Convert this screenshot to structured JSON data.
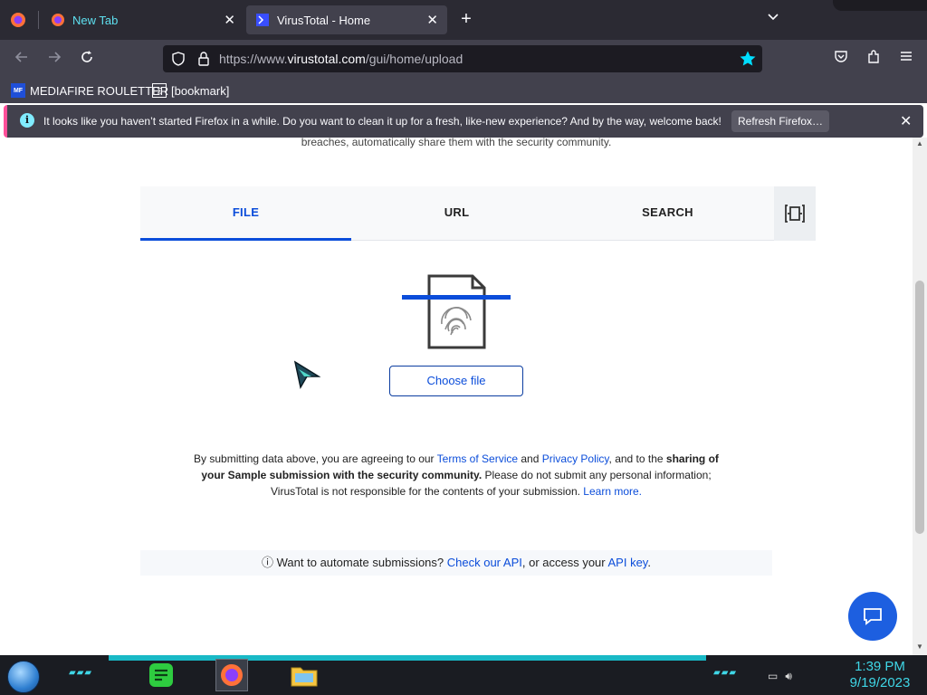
{
  "browser": {
    "tabs": [
      {
        "title": "New Tab",
        "active": false
      },
      {
        "title": "VirusTotal - Home",
        "active": true
      }
    ],
    "url_prefix": "https://www.",
    "url_domain": "virustotal.com",
    "url_path": "/gui/home/upload",
    "bookmarks": [
      {
        "label": "MEDIAFIRE ROULETTER",
        "icon": "mediafire-icon"
      },
      {
        "label": "[bookmark]",
        "icon": "bookmark-folder-icon"
      }
    ],
    "notification": {
      "text": "It looks like you haven’t started Firefox in a while. Do you want to clean it up for a fresh, like-new experience? And by the way, welcome back!",
      "button": "Refresh Firefox…"
    }
  },
  "page": {
    "top_text": "breaches, automatically share them with the security community.",
    "tabs": [
      "FILE",
      "URL",
      "SEARCH"
    ],
    "active_tab": "FILE",
    "choose_file": "Choose file",
    "legal": {
      "p1": "By submitting data above, you are agreeing to our ",
      "tos": "Terms of Service",
      "and": " and ",
      "privacy": "Privacy Policy",
      "p2": ", and to the ",
      "bold": "sharing of your Sample submission with the security community.",
      "p3": " Please do not submit any personal information; VirusTotal is not responsible for the contents of your submission. ",
      "learn": "Learn more."
    },
    "api": {
      "icon": "ⓘ",
      "p1": "Want to automate submissions? ",
      "api_link": "Check our API",
      "p2": ", or access your ",
      "key_link": "API key",
      "p3": "."
    }
  },
  "taskbar": {
    "time": "1:39 PM",
    "date": "9/19/2023"
  },
  "colors": {
    "accent": "#0b4dda",
    "chrome_dark": "#2b2a33",
    "chrome": "#42414d",
    "chat_button": "#1d5fe0"
  }
}
